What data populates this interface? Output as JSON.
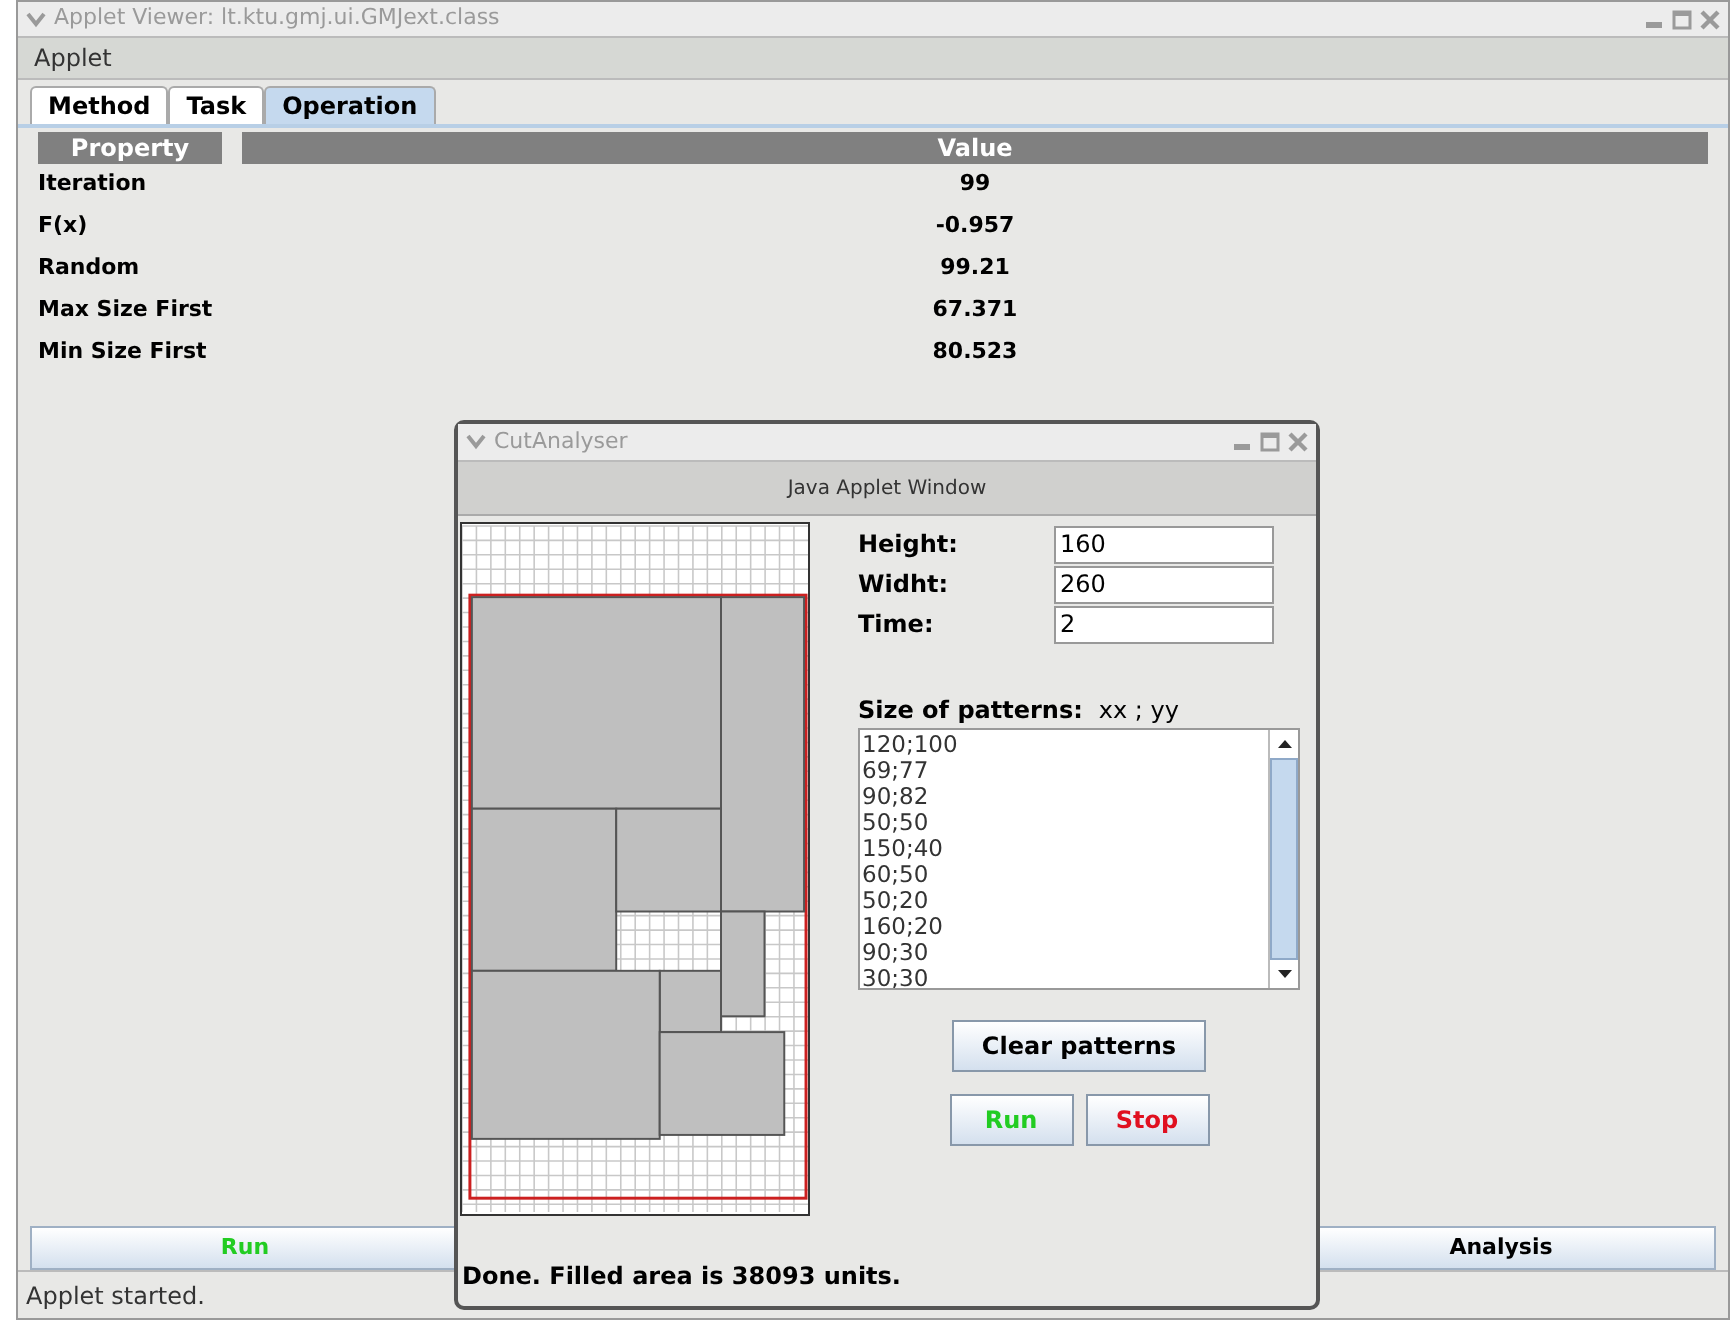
{
  "window": {
    "title": "Applet Viewer: lt.ktu.gmj.ui.GMJext.class"
  },
  "menu": [
    "Applet"
  ],
  "tabs": [
    {
      "label": "Method",
      "selected": false
    },
    {
      "label": "Task",
      "selected": false
    },
    {
      "label": "Operation",
      "selected": true
    }
  ],
  "table": {
    "columns": [
      "Property",
      "Value"
    ],
    "rows": [
      [
        "Iteration",
        "99"
      ],
      [
        "F(x)",
        "-0.957"
      ],
      [
        "Random",
        "99.21"
      ],
      [
        "Max Size First",
        "67.371"
      ],
      [
        "Min Size First",
        "80.523"
      ]
    ]
  },
  "bottom_buttons": [
    {
      "label": "Run",
      "kind": "run"
    },
    {
      "label": "Analysis",
      "kind": "plain"
    }
  ],
  "status_bar": "Applet started.",
  "dialog": {
    "title": "CutAnalyser",
    "banner": "Java Applet Window",
    "fields": [
      {
        "label": "Height:",
        "value": "160"
      },
      {
        "label": "Widht:",
        "value": "260"
      },
      {
        "label": "Time:",
        "value": "2"
      }
    ],
    "patterns_label": "Size of patterns:",
    "patterns_hint": "xx ; yy",
    "patterns": [
      "120;100",
      "69;77",
      "90;82",
      "50;50",
      "150;40",
      "60;50",
      "50;20",
      "160;20",
      "90;30",
      "30;30"
    ],
    "clear_button": "Clear patterns",
    "buttons": [
      {
        "label": "Run",
        "kind": "run"
      },
      {
        "label": "Stop",
        "kind": "stop"
      }
    ],
    "status": "Done. Filled area is 38093 units."
  }
}
